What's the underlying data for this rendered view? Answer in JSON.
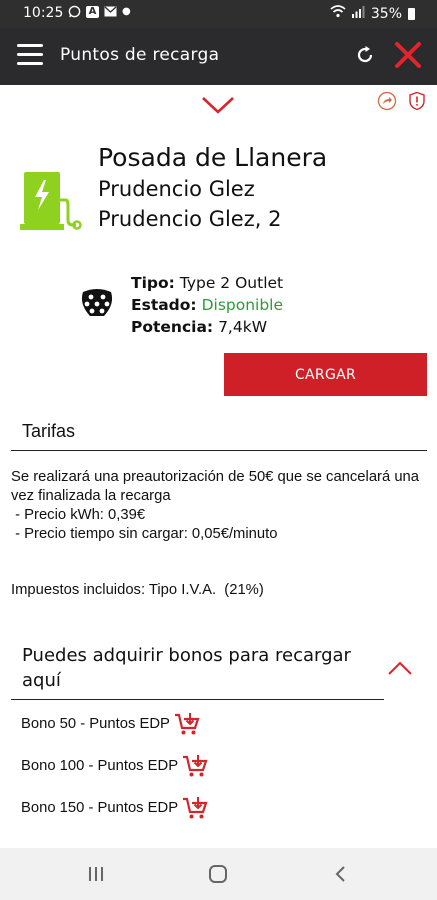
{
  "status_bar": {
    "time": "10:25",
    "battery": "35%",
    "icons": [
      "whatsapp-icon",
      "a-icon",
      "mail-icon",
      "dot-icon",
      "wifi-icon",
      "signal-icon",
      "battery-icon"
    ]
  },
  "app_bar": {
    "title": "Puntos de recarga",
    "icons": [
      "menu-icon",
      "refresh-icon",
      "close-icon"
    ]
  },
  "station": {
    "name": "Posada de Llanera",
    "operator": "Prudencio Glez",
    "address": "Prudencio Glez, 2"
  },
  "connector": {
    "type_label": "Tipo:",
    "type_value": "Type 2 Outlet",
    "state_label": "Estado:",
    "state_value": "Disponible",
    "power_label": "Potencia:",
    "power_value": "7,4kW"
  },
  "charge_button": "CARGAR",
  "tariffs": {
    "title": "Tarifas",
    "description": "Se realizará una preautorización de 50€ que se cancelará una vez finalizada la recarga",
    "lines": [
      " - Precio kWh: 0,39€",
      " - Precio tiempo sin cargar: 0,05€/minuto"
    ],
    "tax": "Impuestos incluidos: Tipo I.V.A.  (21%)"
  },
  "bonuses": {
    "title": "Puedes adquirir bonos para recargar aquí",
    "items": [
      {
        "label": "Bono 50 - Puntos EDP"
      },
      {
        "label": "Bono 100 - Puntos EDP"
      },
      {
        "label": "Bono 150 - Puntos EDP"
      }
    ]
  },
  "colors": {
    "accent": "#cf2027",
    "app_bar": "#2b2b2d",
    "station_green": "#8fd11f",
    "available_green": "#2e9b36"
  }
}
